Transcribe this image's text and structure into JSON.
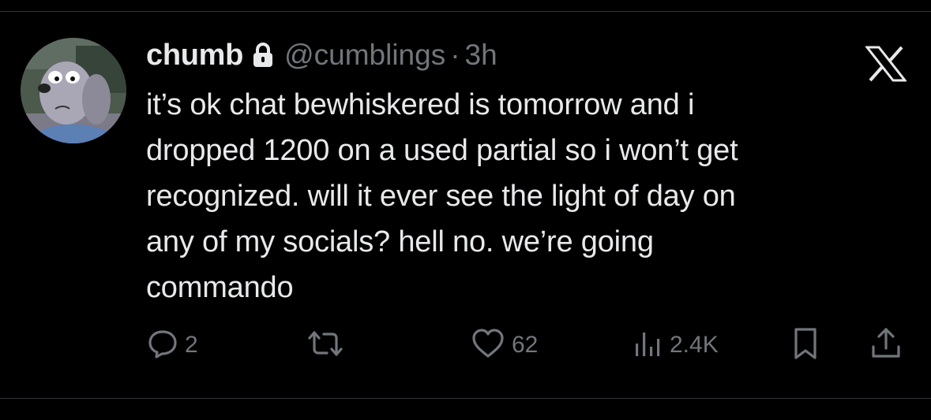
{
  "tweet": {
    "display_name": "chumb",
    "handle": "@cumblings",
    "separator": "·",
    "time": "3h",
    "text": "it’s ok chat bewhiskered is tomorrow and i\ndropped 1200 on a used partial so i won’t get\nrecognized. will it ever see the light of day on\nany of my socials? hell no. we’re going\ncommando",
    "protected_icon": "lock-icon",
    "platform_icon": "x-logo-icon"
  },
  "actions": {
    "replies": "2",
    "likes": "62",
    "views": "2.4K",
    "icons": [
      "reply-icon",
      "retweet-icon",
      "like-icon",
      "views-icon",
      "bookmark-icon",
      "share-icon"
    ]
  },
  "colors": {
    "background": "#000000",
    "text_primary": "#e7e9ea",
    "text_secondary": "#71767b",
    "divider": "#2f3336"
  }
}
